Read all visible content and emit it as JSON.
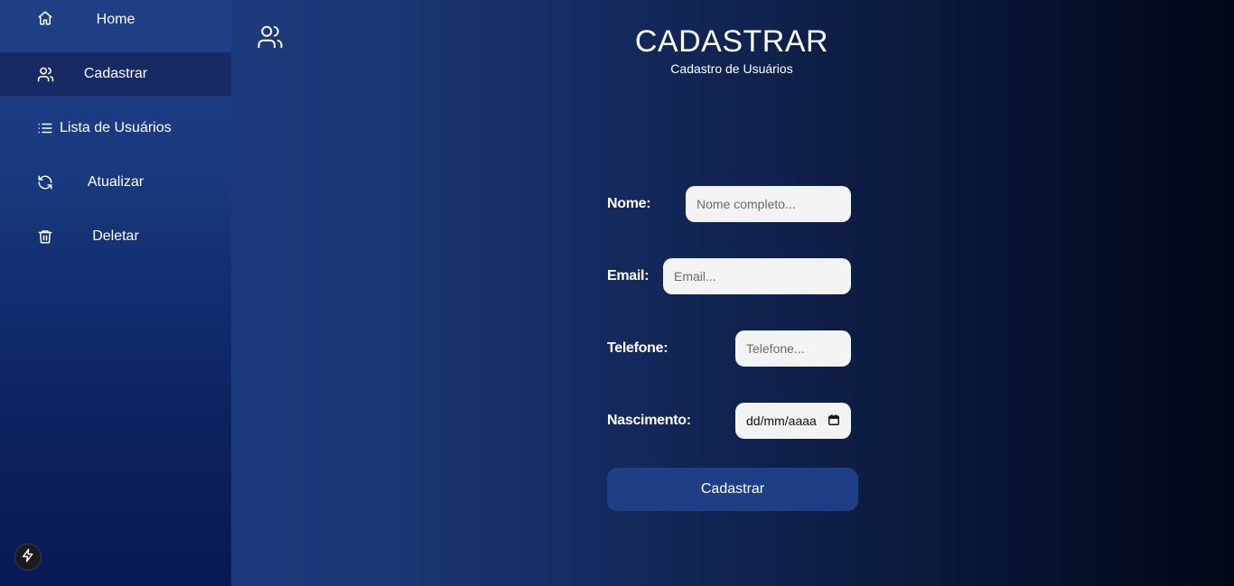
{
  "sidebar": {
    "items": [
      {
        "label": "Home",
        "icon": "home-icon"
      },
      {
        "label": "Cadastrar",
        "icon": "users-icon",
        "active": true
      },
      {
        "label": "Lista de Usuários",
        "icon": "list-icon"
      },
      {
        "label": "Atualizar",
        "icon": "refresh-icon"
      },
      {
        "label": "Deletar",
        "icon": "trash-icon"
      }
    ],
    "bolt_icon": "bolt-icon"
  },
  "header": {
    "icon": "users-icon",
    "title": "CADASTRAR",
    "subtitle": "Cadastro de Usuários"
  },
  "form": {
    "nome": {
      "label": "Nome:",
      "placeholder": "Nome completo...",
      "value": ""
    },
    "email": {
      "label": "Email:",
      "placeholder": "Email...",
      "value": ""
    },
    "telefone": {
      "label": "Telefone:",
      "placeholder": "Telefone...",
      "value": ""
    },
    "nascimento": {
      "label": "Nascimento:",
      "value_display": "dd/mm/aaaa",
      "icon": "calendar-icon"
    },
    "submit_label": "Cadastrar"
  },
  "colors": {
    "sidebar_top": "#1e3f86",
    "sidebar_active": "#172a63",
    "button_bg": "#1e3f86",
    "input_bg": "#f3f3f3"
  }
}
